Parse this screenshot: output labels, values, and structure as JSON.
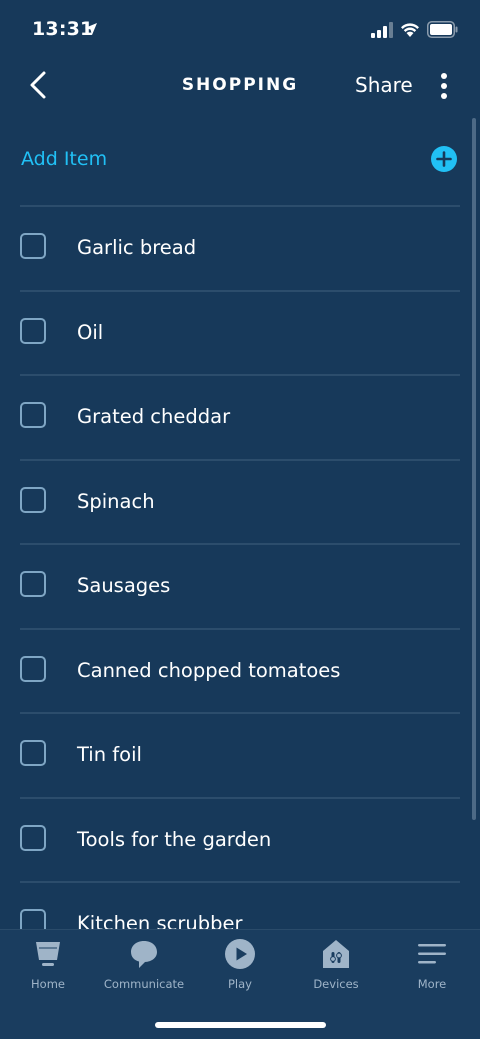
{
  "status_bar": {
    "time": "13:31"
  },
  "header": {
    "title": "SHOPPING",
    "share_label": "Share"
  },
  "add_item": {
    "label": "Add Item"
  },
  "list": {
    "items": [
      {
        "label": "Garlic bread",
        "checked": false
      },
      {
        "label": "Oil",
        "checked": false
      },
      {
        "label": "Grated cheddar",
        "checked": false
      },
      {
        "label": "Spinach",
        "checked": false
      },
      {
        "label": "Sausages",
        "checked": false
      },
      {
        "label": "Canned chopped tomatoes",
        "checked": false
      },
      {
        "label": "Tin foil",
        "checked": false
      },
      {
        "label": "Tools for the garden",
        "checked": false
      },
      {
        "label": "Kitchen scrubber",
        "checked": false
      }
    ]
  },
  "bottom_nav": {
    "items": [
      {
        "label": "Home",
        "icon": "home-icon"
      },
      {
        "label": "Communicate",
        "icon": "chat-bubble-icon"
      },
      {
        "label": "Play",
        "icon": "play-icon"
      },
      {
        "label": "Devices",
        "icon": "smart-home-icon"
      },
      {
        "label": "More",
        "icon": "menu-lines-icon"
      }
    ]
  },
  "colors": {
    "background": "#17395a",
    "accent": "#21c0f5",
    "divider": "#2c4d6c",
    "checkbox_border": "#7fa6c4",
    "nav_label": "#9fb4c8"
  }
}
